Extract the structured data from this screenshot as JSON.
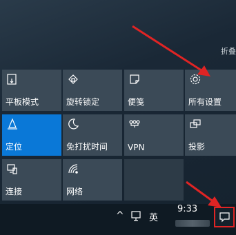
{
  "panel": {
    "collapse_label": "折叠",
    "tiles": [
      {
        "label": "平板模式",
        "icon": "tablet-mode-icon"
      },
      {
        "label": "旋转锁定",
        "icon": "rotation-lock-icon"
      },
      {
        "label": "便笺",
        "icon": "note-icon"
      },
      {
        "label": "所有设置",
        "icon": "gear-icon"
      },
      {
        "label": "定位",
        "icon": "location-icon",
        "active": true
      },
      {
        "label": "免打扰时间",
        "icon": "moon-icon"
      },
      {
        "label": "VPN",
        "icon": "vpn-icon"
      },
      {
        "label": "投影",
        "icon": "project-icon"
      },
      {
        "label": "连接",
        "icon": "connect-icon"
      },
      {
        "label": "网络",
        "icon": "network-icon"
      }
    ]
  },
  "taskbar": {
    "chevron": "^",
    "ime": "英",
    "time": "9:33"
  },
  "colors": {
    "tile": "#3b4a57",
    "tile_active": "#0a78d7",
    "annotation": "#e02424"
  }
}
